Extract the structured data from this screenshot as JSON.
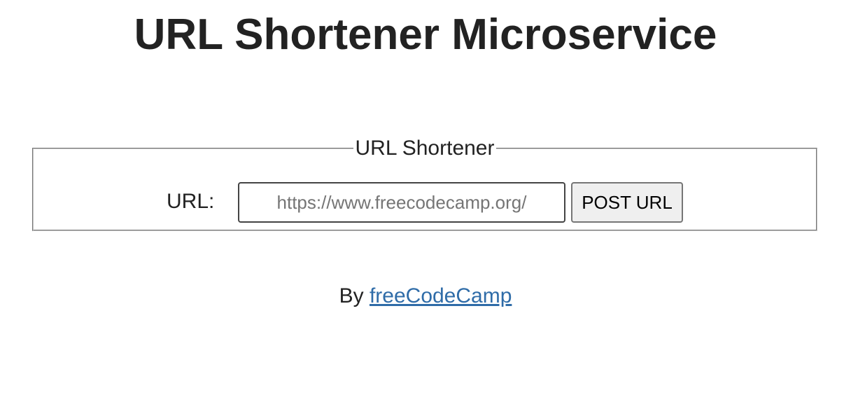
{
  "page": {
    "title": "URL Shortener Microservice"
  },
  "form": {
    "legend": "URL Shortener",
    "url_label": "URL:",
    "url_input_placeholder": "https://www.freecodecamp.org/",
    "url_input_value": "",
    "submit_label": "POST URL"
  },
  "footer": {
    "by_text": "By ",
    "link_text": "freeCodeCamp"
  },
  "colors": {
    "text": "#222222",
    "link": "#2f6ca8",
    "button_bg": "#efefef",
    "fieldset_border": "#c7c7c7"
  }
}
